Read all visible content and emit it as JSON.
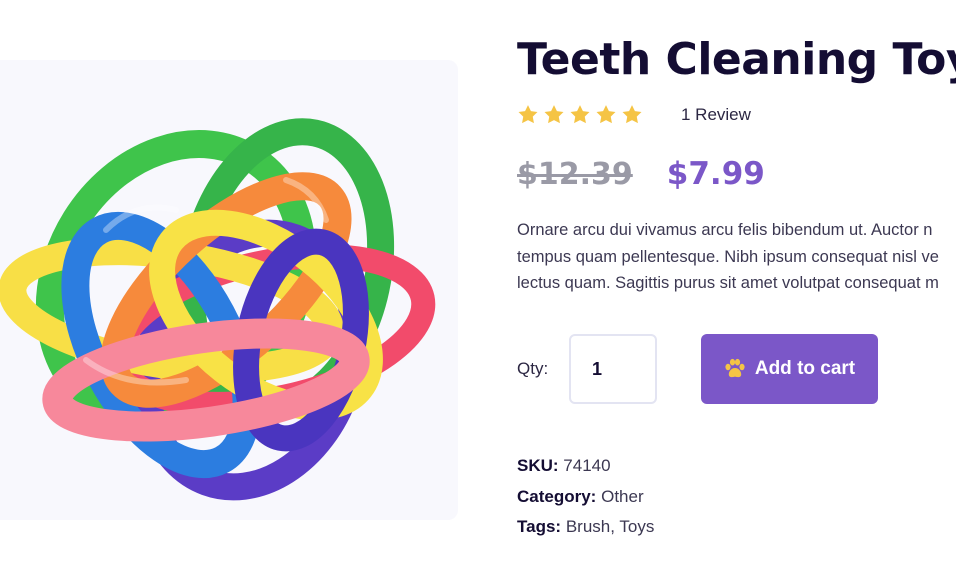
{
  "product": {
    "title": "Teeth Cleaning Toy",
    "image_alt": "Colorful knotted rubber ball toy",
    "rating": {
      "stars": 5,
      "max": 5,
      "review_text": "1 Review"
    },
    "price": {
      "old": "$12.39",
      "current": "$7.99"
    },
    "description_lines": [
      "Ornare arcu dui vivamus arcu felis bibendum ut. Auctor n",
      "tempus quam pellentesque. Nibh ipsum consequat nisl ve",
      "lectus quam. Sagittis purus sit amet volutpat consequat m"
    ],
    "quantity": {
      "label": "Qty:",
      "value": "1"
    },
    "add_to_cart": {
      "label": "Add to cart",
      "icon": "paw-icon"
    },
    "meta": {
      "sku_label": "SKU:",
      "sku": "74140",
      "category_label": "Category:",
      "category": "Other",
      "tags_label": "Tags:",
      "tags": [
        "Brush",
        "Toys"
      ],
      "tag_separator": ", "
    }
  },
  "colors": {
    "accent": "#7b57c8",
    "star": "#f5c445",
    "title": "#140d33",
    "old_price": "#9a9aa6",
    "image_bg": "#f8f8fd"
  }
}
